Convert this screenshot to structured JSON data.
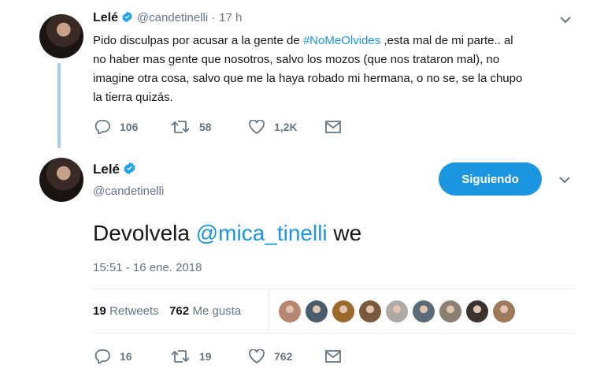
{
  "tweet1": {
    "name": "Lelé",
    "handle": "@candetinelli",
    "sep": "·",
    "time": "17 h",
    "text_parts": {
      "t1": "Pido disculpas por acusar a la gente de ",
      "hashtag": "#NoMeOlvides",
      "t2": " ,esta mal de mi parte.. al",
      "line2": "no haber mas gente que nosotros, salvo los mozos (que nos trataron mal), no",
      "line3": "imagine otra cosa, salvo que me la haya robado mi hermana, o no se, se la chupo",
      "line4": "la tierra quizás."
    },
    "replies": "106",
    "retweets": "58",
    "likes": "1,2K"
  },
  "tweet2": {
    "name": "Lelé",
    "handle": "@candetinelli",
    "follow_label": "Siguiendo",
    "text_pre": "Devolvela ",
    "mention": "@mica_tinelli",
    "text_post": " we",
    "timestamp": "15:51 - 16 ene. 2018",
    "stats": {
      "retweets_num": "19",
      "retweets_lbl": "Retweets",
      "likes_num": "762",
      "likes_lbl": "Me gusta"
    },
    "likers": [
      {
        "color": "#b8876f"
      },
      {
        "color": "#4a5d6b"
      },
      {
        "color": "#9a6a2c"
      },
      {
        "color": "#7a5a3c"
      },
      {
        "color": "#b0aaa6"
      },
      {
        "color": "#5b6b7a"
      },
      {
        "color": "#8b7f6f"
      },
      {
        "color": "#3b3330"
      },
      {
        "color": "#a07a5c"
      }
    ],
    "replies": "16",
    "retweets": "19",
    "likes": "762"
  },
  "colors": {
    "accent": "#1b95e0",
    "thread": "#a6cfe6",
    "muted": "#657786"
  },
  "icons": [
    "verified-icon",
    "reply-icon",
    "retweet-icon",
    "like-icon",
    "dm-icon",
    "chevron-down-icon"
  ]
}
